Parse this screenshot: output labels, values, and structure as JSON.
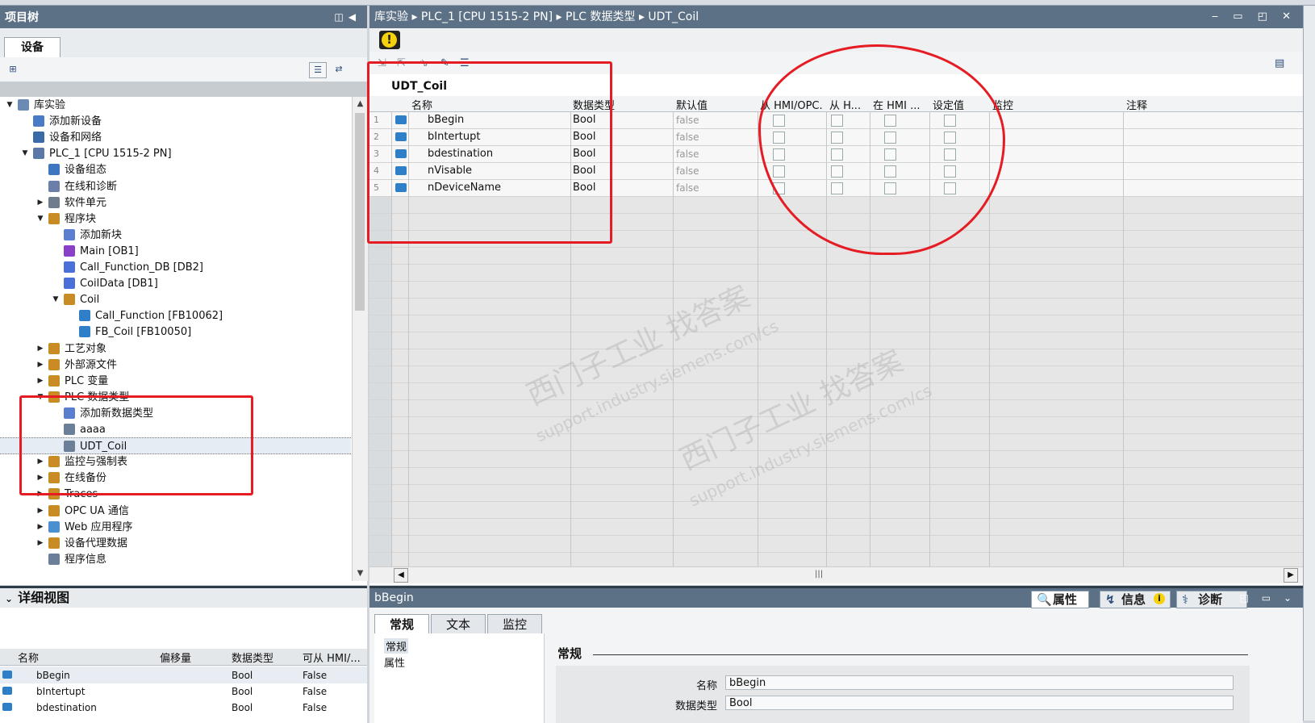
{
  "project_tree": {
    "title": "项目树",
    "device_tab": "设备",
    "items": [
      {
        "label": "库实验",
        "level": 0,
        "arrow": "down"
      },
      {
        "label": "添加新设备",
        "level": 1,
        "arrow": ""
      },
      {
        "label": "设备和网络",
        "level": 1,
        "arrow": ""
      },
      {
        "label": "PLC_1 [CPU 1515-2 PN]",
        "level": 1,
        "arrow": "down"
      },
      {
        "label": "设备组态",
        "level": 2,
        "arrow": ""
      },
      {
        "label": "在线和诊断",
        "level": 2,
        "arrow": ""
      },
      {
        "label": "软件单元",
        "level": 2,
        "arrow": "right"
      },
      {
        "label": "程序块",
        "level": 2,
        "arrow": "down"
      },
      {
        "label": "添加新块",
        "level": 3,
        "arrow": ""
      },
      {
        "label": "Main [OB1]",
        "level": 3,
        "arrow": ""
      },
      {
        "label": "Call_Function_DB [DB2]",
        "level": 3,
        "arrow": ""
      },
      {
        "label": "CoilData [DB1]",
        "level": 3,
        "arrow": ""
      },
      {
        "label": "Coil",
        "level": 3,
        "arrow": "down"
      },
      {
        "label": "Call_Function [FB10062]",
        "level": 4,
        "arrow": ""
      },
      {
        "label": "FB_Coil [FB10050]",
        "level": 4,
        "arrow": ""
      },
      {
        "label": "工艺对象",
        "level": 2,
        "arrow": "right"
      },
      {
        "label": "外部源文件",
        "level": 2,
        "arrow": "right"
      },
      {
        "label": "PLC 变量",
        "level": 2,
        "arrow": "right"
      },
      {
        "label": "PLC 数据类型",
        "level": 2,
        "arrow": "down"
      },
      {
        "label": "添加新数据类型",
        "level": 3,
        "arrow": ""
      },
      {
        "label": "aaaa",
        "level": 3,
        "arrow": ""
      },
      {
        "label": "UDT_Coil",
        "level": 3,
        "arrow": "",
        "selected": true
      },
      {
        "label": "监控与强制表",
        "level": 2,
        "arrow": "right"
      },
      {
        "label": "在线备份",
        "level": 2,
        "arrow": "right"
      },
      {
        "label": "Traces",
        "level": 2,
        "arrow": "right"
      },
      {
        "label": "OPC UA 通信",
        "level": 2,
        "arrow": "right"
      },
      {
        "label": "Web 应用程序",
        "level": 2,
        "arrow": "right"
      },
      {
        "label": "设备代理数据",
        "level": 2,
        "arrow": "right"
      },
      {
        "label": "程序信息",
        "level": 2,
        "arrow": ""
      }
    ]
  },
  "detail_view": {
    "title": "详细视图",
    "columns": [
      "名称",
      "偏移量",
      "数据类型",
      "可从 HMI/..."
    ],
    "rows": [
      {
        "name": "bBegin",
        "type": "Bool",
        "hmi": "False"
      },
      {
        "name": "bIntertupt",
        "type": "Bool",
        "hmi": "False"
      },
      {
        "name": "bdestination",
        "type": "Bool",
        "hmi": "False"
      }
    ]
  },
  "editor": {
    "breadcrumb": "库实验  ▸  PLC_1 [CPU 1515-2 PN]  ▸  PLC 数据类型  ▸  UDT_Coil",
    "udt_name": "UDT_Coil",
    "columns": [
      "名称",
      "数据类型",
      "默认值",
      "从 HMI/OPC...",
      "从 H...",
      "在 HMI ...",
      "设定值",
      "监控",
      "注释"
    ],
    "rows": [
      {
        "num": "1",
        "name": "bBegin",
        "type": "Bool",
        "default": "false"
      },
      {
        "num": "2",
        "name": "bIntertupt",
        "type": "Bool",
        "default": "false"
      },
      {
        "num": "3",
        "name": "bdestination",
        "type": "Bool",
        "default": "false"
      },
      {
        "num": "4",
        "name": "nVisable",
        "type": "Bool",
        "default": "false"
      },
      {
        "num": "5",
        "name": "nDeviceName",
        "type": "Bool",
        "default": "false"
      }
    ]
  },
  "watermark": {
    "line1": "西门子工业  找答案",
    "line2": "support.industry.siemens.com/cs"
  },
  "inspector": {
    "title": "bBegin",
    "top_tabs": [
      "属性",
      "信息",
      "诊断"
    ],
    "tabs": [
      "常规",
      "文本",
      "监控"
    ],
    "nav": [
      "常规",
      "属性"
    ],
    "section": "常规",
    "fields": [
      {
        "label": "名称",
        "value": "bBegin"
      },
      {
        "label": "数据类型",
        "value": "Bool"
      }
    ]
  },
  "colors": {
    "titlebar": "#5d7186",
    "annotation_red": "#e51c23",
    "warning_yellow": "#f5d20c"
  }
}
